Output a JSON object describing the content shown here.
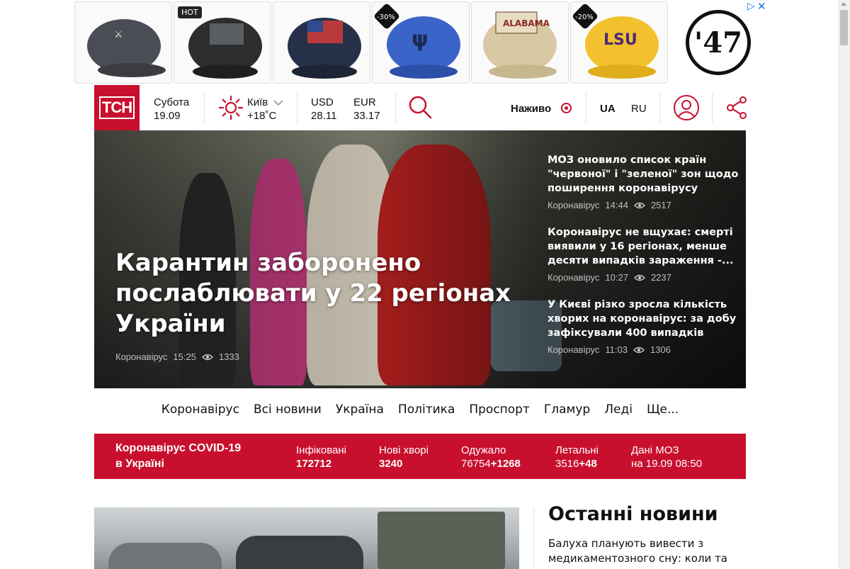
{
  "ad": {
    "tags": [
      "HOT",
      "-30%",
      "-20%"
    ],
    "brand": "'47",
    "close": "✕",
    "info": "▷"
  },
  "header": {
    "logo": "ТСН",
    "day": "Субота",
    "date": "19.09",
    "city": "Київ",
    "temperature": "+18˚C",
    "usd_label": "USD",
    "usd_value": "28.11",
    "eur_label": "EUR",
    "eur_value": "33.17",
    "live_label": "Наживо",
    "lang_ua": "UA",
    "lang_ru": "RU"
  },
  "hero": {
    "title": "Карантин заборонено послаблювати у 22 регіонах України",
    "category": "Коронавірус",
    "time": "15:25",
    "views": "1333"
  },
  "side_news": [
    {
      "title": "МОЗ оновило список країн \"червоної\" і \"зеленої\" зон щодо поширення коронавірусу",
      "category": "Коронавірус",
      "time": "14:44",
      "views": "2517"
    },
    {
      "title": "Коронавірус не вщухає: смерті виявили у 16 регіонах, менше десяти випадків зараження -...",
      "category": "Коронавірус",
      "time": "10:27",
      "views": "2237"
    },
    {
      "title": "У Києві різко зросла кількість хворих на коронавірус: за добу зафіксували 400 випадків",
      "category": "Коронавірус",
      "time": "11:03",
      "views": "1306"
    }
  ],
  "nav": [
    "Коронавірус",
    "Всі новини",
    "Україна",
    "Політика",
    "Проспорт",
    "Гламур",
    "Леді",
    "Ще..."
  ],
  "covid": {
    "title_line1": "Коронавірус COVID-19",
    "title_line2": "в Україні",
    "infected_label": "Інфіковані",
    "infected_value": "172712",
    "new_label": "Нові хворі",
    "new_value": "3240",
    "recovered_label": "Одужало",
    "recovered_value": "76754",
    "recovered_delta": "+1268",
    "deaths_label": "Летальні",
    "deaths_value": "3516",
    "deaths_delta": "+48",
    "source_label": "Дані МОЗ",
    "source_date": "на 19.09 08:50"
  },
  "latest": {
    "heading": "Останні новини",
    "first_item": "Балуха планують вивести з медикаментозного сну: коли та за"
  },
  "colors": {
    "brand": "#c8102e"
  }
}
